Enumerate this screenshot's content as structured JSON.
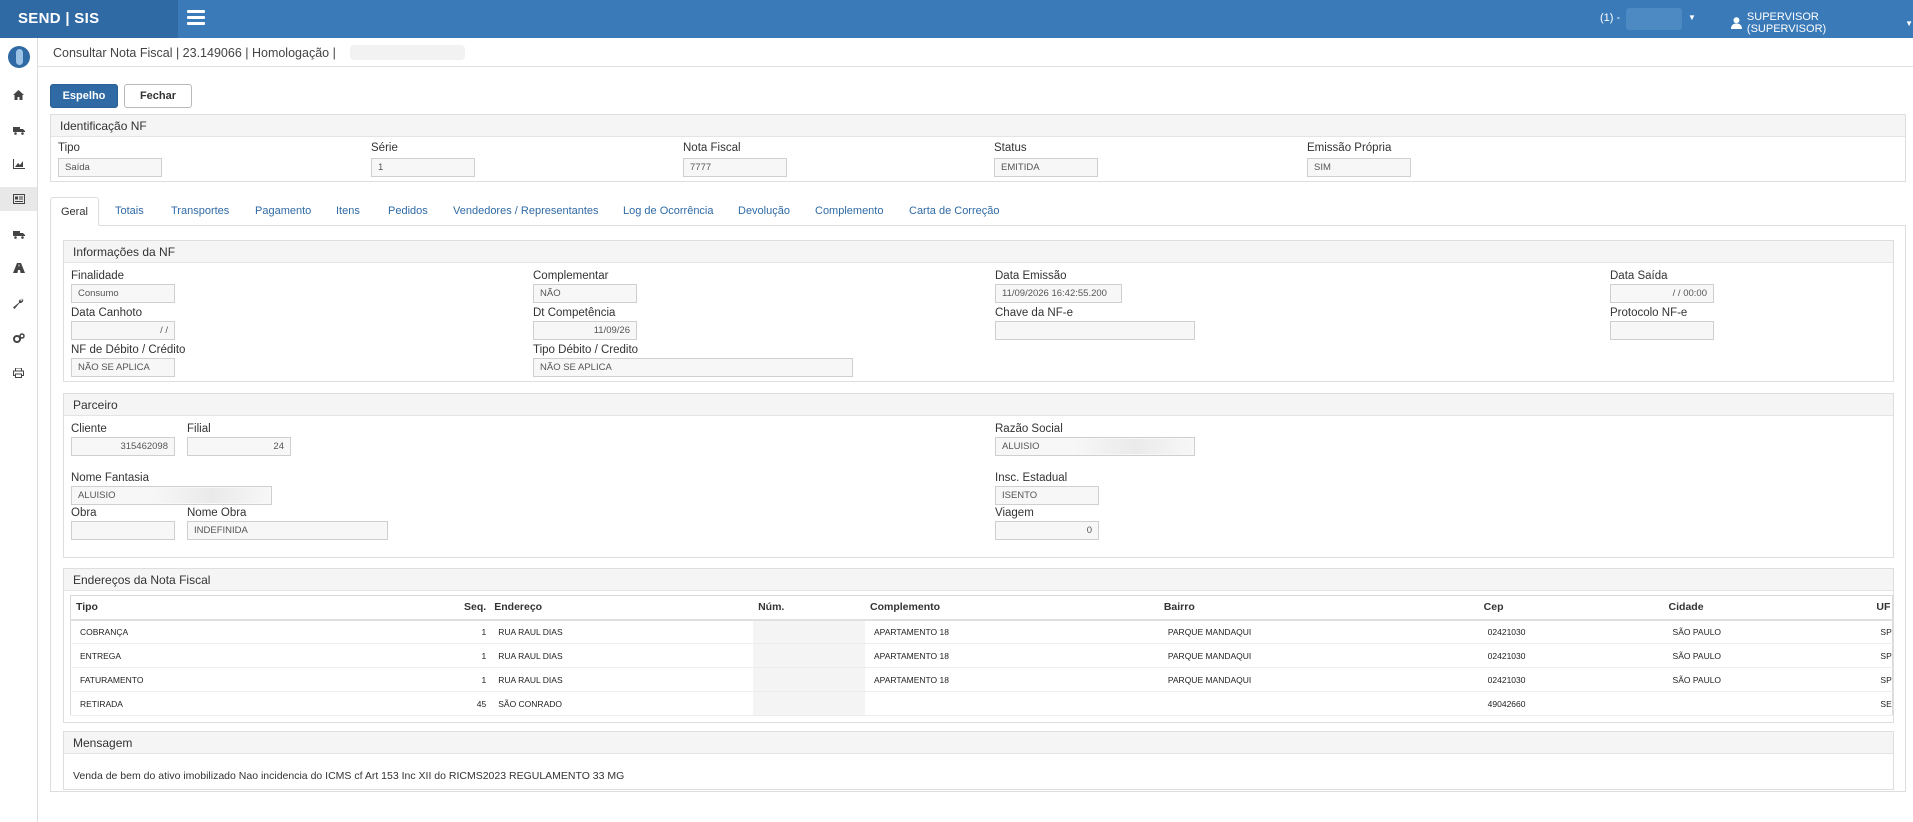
{
  "app": {
    "brand": "SEND | SIS",
    "unit_label": "(1) -",
    "user": "SUPERVISOR (SUPERVISOR)"
  },
  "breadcrumb": "Consultar Nota Fiscal | 23.149066 | Homologação |",
  "toolbar": {
    "espelho": "Espelho",
    "fechar": "Fechar"
  },
  "identificacao": {
    "title": "Identificação NF",
    "tipo_label": "Tipo",
    "tipo": "Saída",
    "serie_label": "Série",
    "serie": "1",
    "nf_label": "Nota Fiscal",
    "nf": "7777",
    "status_label": "Status",
    "status": "EMITIDA",
    "emissao_label": "Emissão Própria",
    "emissao": "SIM"
  },
  "tabs": [
    "Geral",
    "Totais",
    "Transportes",
    "Pagamento",
    "Itens",
    "Pedidos",
    "Vendedores / Representantes",
    "Log de Ocorrência",
    "Devolução",
    "Complemento",
    "Carta de Correção"
  ],
  "info": {
    "title": "Informações da NF",
    "finalidade_label": "Finalidade",
    "finalidade": "Consumo",
    "complementar_label": "Complementar",
    "complementar": "NÃO",
    "data_emissao_label": "Data Emissão",
    "data_emissao": "11/09/2026 16:42:55.200",
    "data_saida_label": "Data Saída",
    "data_saida": "/ / 00:00",
    "data_canhoto_label": "Data Canhoto",
    "data_canhoto": "/ /",
    "dt_competencia_label": "Dt Competência",
    "dt_competencia": "11/09/26",
    "chave_label": "Chave da NF-e",
    "chave": "",
    "protocolo_label": "Protocolo NF-e",
    "protocolo": "",
    "nf_debito_label": "NF de Débito / Crédito",
    "nf_debito": "NÃO SE APLICA",
    "tipo_debito_label": "Tipo Débito / Credito",
    "tipo_debito": "NÃO SE APLICA"
  },
  "parceiro": {
    "title": "Parceiro",
    "cliente_label": "Cliente",
    "cliente": "315462098",
    "filial_label": "Filial",
    "filial": "24",
    "razao_label": "Razão Social",
    "razao": "ALUISIO",
    "fantasia_label": "Nome Fantasia",
    "fantasia": "ALUISIO",
    "insc_label": "Insc. Estadual",
    "insc": "ISENTO",
    "obra_label": "Obra",
    "obra": "",
    "nome_obra_label": "Nome Obra",
    "nome_obra": "INDEFINIDA",
    "viagem_label": "Viagem",
    "viagem": "0"
  },
  "enderecos": {
    "title": "Endereços da Nota Fiscal",
    "headers": [
      "Tipo",
      "Seq.",
      "Endereço",
      "Núm.",
      "Complemento",
      "Bairro",
      "Cep",
      "Cidade",
      "UF"
    ],
    "rows": [
      [
        "COBRANÇA",
        "1",
        "RUA RAUL DIAS",
        "",
        "APARTAMENTO 18",
        "PARQUE MANDAQUI",
        "02421030",
        "SÃO PAULO",
        "SP"
      ],
      [
        "ENTREGA",
        "1",
        "RUA RAUL DIAS",
        "",
        "APARTAMENTO 18",
        "PARQUE MANDAQUI",
        "02421030",
        "SÃO PAULO",
        "SP"
      ],
      [
        "FATURAMENTO",
        "1",
        "RUA RAUL DIAS",
        "",
        "APARTAMENTO 18",
        "PARQUE MANDAQUI",
        "02421030",
        "SÃO PAULO",
        "SP"
      ],
      [
        "RETIRADA",
        "45",
        "SÃO CONRADO",
        "",
        "",
        "",
        "49042660",
        "",
        "SE"
      ]
    ]
  },
  "mensagem": {
    "title": "Mensagem",
    "text": "Venda de bem do ativo imobilizado Nao incidencia do ICMS cf Art 153 Inc XII do RICMS2023 REGULAMENTO 33 MG"
  }
}
